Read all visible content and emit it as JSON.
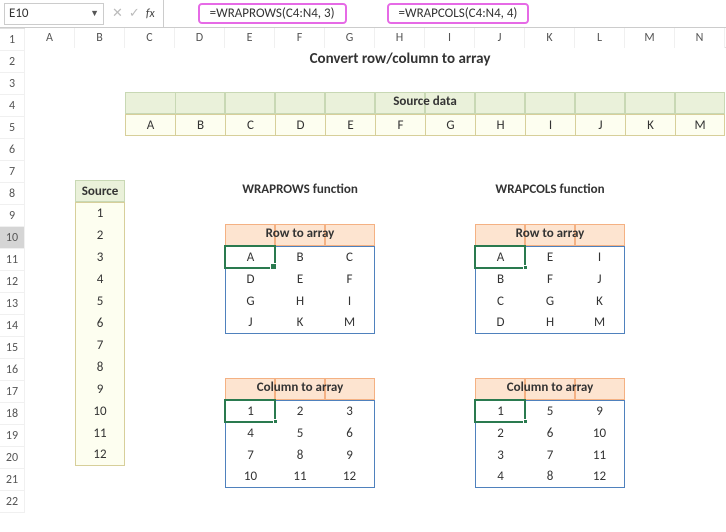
{
  "namebox": "E10",
  "formula1": "=WRAPROWS(C4:N4, 3)",
  "formula2": "=WRAPCOLS(C4:N4, 4)",
  "cols": [
    "A",
    "B",
    "C",
    "D",
    "E",
    "F",
    "G",
    "H",
    "I",
    "J",
    "K",
    "L",
    "M",
    "N"
  ],
  "rows": [
    "1",
    "2",
    "3",
    "4",
    "5",
    "6",
    "7",
    "8",
    "9",
    "10",
    "11",
    "12",
    "13",
    "14",
    "15",
    "16",
    "17",
    "18",
    "19",
    "20",
    "21",
    "22"
  ],
  "title": "Convert row/column to array",
  "sourceDataHeader": "Source data",
  "sourceRow": [
    "A",
    "B",
    "C",
    "D",
    "E",
    "F",
    "G",
    "H",
    "I",
    "J",
    "K",
    "M"
  ],
  "sourceColHeader": "Source",
  "sourceCol": [
    "1",
    "2",
    "3",
    "4",
    "5",
    "6",
    "7",
    "8",
    "9",
    "10",
    "11",
    "12"
  ],
  "funcA": "WRAPROWS function",
  "funcB": "WRAPCOLS function",
  "rowToArray": "Row to array",
  "colToArray": "Column to array",
  "tblA1": [
    [
      "A",
      "B",
      "C"
    ],
    [
      "D",
      "E",
      "F"
    ],
    [
      "G",
      "H",
      "I"
    ],
    [
      "J",
      "K",
      "M"
    ]
  ],
  "tblA2": [
    [
      "1",
      "2",
      "3"
    ],
    [
      "4",
      "5",
      "6"
    ],
    [
      "7",
      "8",
      "9"
    ],
    [
      "10",
      "11",
      "12"
    ]
  ],
  "tblB1": [
    [
      "A",
      "E",
      "I"
    ],
    [
      "B",
      "F",
      "J"
    ],
    [
      "C",
      "G",
      "K"
    ],
    [
      "D",
      "H",
      "M"
    ]
  ],
  "tblB2": [
    [
      "1",
      "5",
      "9"
    ],
    [
      "2",
      "6",
      "10"
    ],
    [
      "3",
      "7",
      "11"
    ],
    [
      "4",
      "8",
      "12"
    ]
  ]
}
